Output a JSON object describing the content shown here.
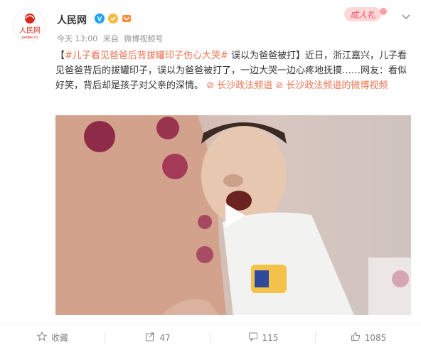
{
  "post": {
    "author": "人民网",
    "avatar_logo_text": "人民网",
    "avatar_logo_sub": "people.cn",
    "time": "今天 13:00",
    "source_prefix": "来自",
    "source": "微博视频号",
    "promo_label": "成人礼",
    "text": {
      "bracket_open": "【",
      "hashtag": "#儿子看见爸爸后背拔罐印子伤心大哭#",
      "headline": " 误以为爸爸被打】",
      "body": "近日，浙江嘉兴，儿子看见爸爸背后的拔罐印子，误以为爸爸被打了，一边大哭一边心疼地抚摸……网友：看似好笑，背后却是孩子对父亲的深情。",
      "link1": "长沙政法频道",
      "link2": "长沙政法频道的微博视频"
    }
  },
  "footer": {
    "favorite_label": "收藏",
    "repost_count": "47",
    "comment_count": "115",
    "like_count": "1085"
  },
  "colors": {
    "link": "#eb7350",
    "meta": "#939393",
    "footer_text": "#808080"
  },
  "icons": [
    "verified-icon",
    "gold-badge-icon",
    "member-icon",
    "chevron-down-icon",
    "play-icon",
    "link-icon",
    "star-icon",
    "repost-icon",
    "comment-icon",
    "like-icon"
  ]
}
